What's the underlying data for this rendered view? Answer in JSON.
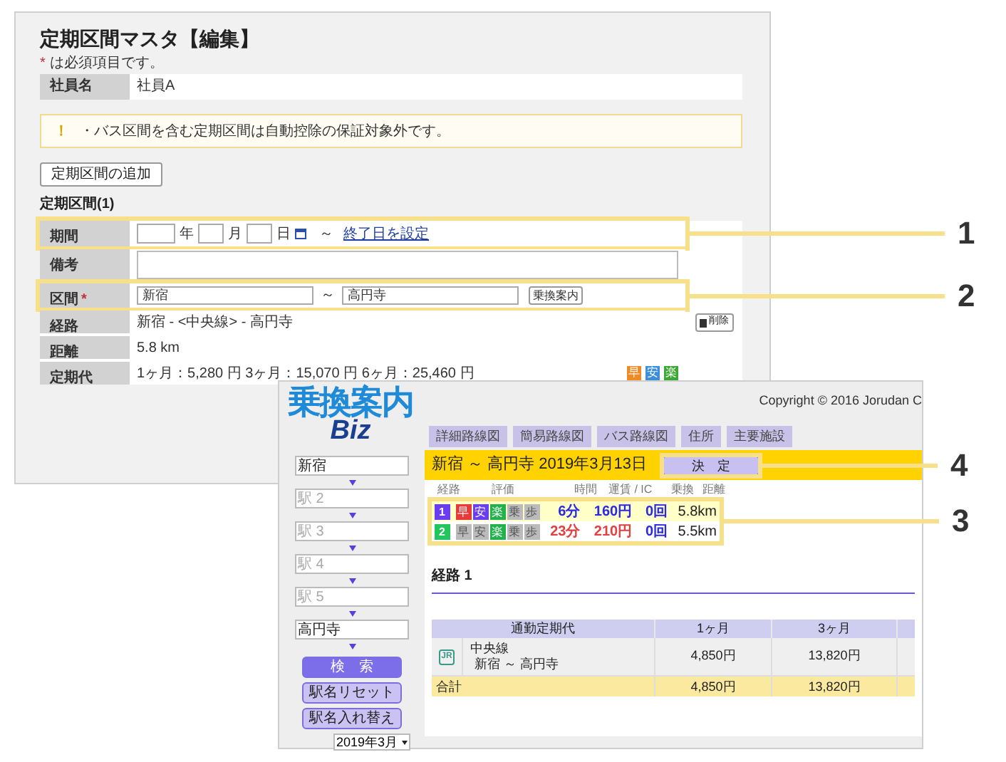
{
  "back_window": {
    "title": "定期区間マスタ【編集】",
    "required_note": {
      "mark": "*",
      "text": "は必須項目です。"
    },
    "employee": {
      "label": "社員名",
      "value": "社員A"
    },
    "warning": {
      "icon": "！",
      "text": "・バス区間を含む定期区間は自動控除の保証対象外です。"
    },
    "add_button": "定期区間の追加",
    "section_title": "定期区間(1)",
    "period": {
      "label": "期間",
      "units": [
        "年",
        "月",
        "日"
      ],
      "separator": "～",
      "link": "終了日を設定"
    },
    "remarks": {
      "label": "備考"
    },
    "segment": {
      "label": "区間",
      "required_mark": "*",
      "from": "新宿",
      "separator": "～",
      "to": "高円寺",
      "button": "乗換案内"
    },
    "delete_button": "削除",
    "route": {
      "label": "経路",
      "value": "新宿 - <中央線> - 高円寺"
    },
    "distance": {
      "label": "距離",
      "value": "5.8 km"
    },
    "fare": {
      "label": "定期代",
      "value": "1ヶ月：5,280 円 3ヶ月：15,070 円 6ヶ月：25,460 円",
      "badges": [
        {
          "text": "早",
          "color": "#f08a24"
        },
        {
          "text": "安",
          "color": "#3a8fd8"
        },
        {
          "text": "楽",
          "color": "#3aa832"
        }
      ]
    }
  },
  "front_window": {
    "logo": {
      "main": "乗換案内",
      "sub": "Biz"
    },
    "copyright": "Copyright © 2016 Jorudan C",
    "tabs": [
      "詳細路線図",
      "簡易路線図",
      "バス路線図",
      "住所",
      "主要施設"
    ],
    "stations": [
      {
        "value": "新宿"
      },
      {
        "placeholder": "駅 2"
      },
      {
        "placeholder": "駅 3"
      },
      {
        "placeholder": "駅 4"
      },
      {
        "placeholder": "駅 5"
      },
      {
        "value": "高円寺"
      }
    ],
    "search_button": "検　索",
    "reset_button": "駅名リセット",
    "swap_button": "駅名入れ替え",
    "month_select": "2019年3月",
    "summary": "新宿 ～ 高円寺 2019年3月13日",
    "decide_button": "決　定",
    "result_headers": [
      "経路",
      "評価",
      "時間",
      "運賃 / IC",
      "乗換",
      "距離"
    ],
    "results": [
      {
        "number": "1",
        "color": "#6a3df0",
        "best": true,
        "badges": [
          {
            "text": "早",
            "on": true,
            "color": "#e83a3a"
          },
          {
            "text": "安",
            "on": true,
            "color": "#6a3df0"
          },
          {
            "text": "楽",
            "on": true,
            "color": "#22b14c"
          },
          {
            "text": "乗",
            "on": false,
            "color": "#bbbbbb"
          },
          {
            "text": "歩",
            "on": false,
            "color": "#bbbbbb"
          }
        ],
        "time": "6分",
        "fare": "160円",
        "transfers": "0回",
        "distance": "5.8km"
      },
      {
        "number": "2",
        "color": "#22c55e",
        "best": false,
        "badges": [
          {
            "text": "早",
            "on": false,
            "color": "#bbbbbb"
          },
          {
            "text": "安",
            "on": false,
            "color": "#bbbbbb"
          },
          {
            "text": "楽",
            "on": true,
            "color": "#22b14c"
          },
          {
            "text": "乗",
            "on": false,
            "color": "#bbbbbb"
          },
          {
            "text": "歩",
            "on": false,
            "color": "#bbbbbb"
          }
        ],
        "time": "23分",
        "fare": "210円",
        "transfers": "0回",
        "distance": "5.5km"
      }
    ],
    "route_title": "経路 1",
    "fare_table": {
      "columns": [
        "通勤定期代",
        "1ヶ月",
        "3ヶ月"
      ],
      "rows": [
        {
          "kind": "line",
          "operator": "JR",
          "line": "中央線",
          "section": "新宿 ～ 高円寺",
          "values": [
            "4,850円",
            "13,820円"
          ]
        },
        {
          "kind": "total",
          "label": "合計",
          "values": [
            "4,850円",
            "13,820円"
          ]
        }
      ]
    }
  },
  "annotations": [
    {
      "number": "1"
    },
    {
      "number": "2"
    },
    {
      "number": "4"
    },
    {
      "number": "3"
    }
  ]
}
